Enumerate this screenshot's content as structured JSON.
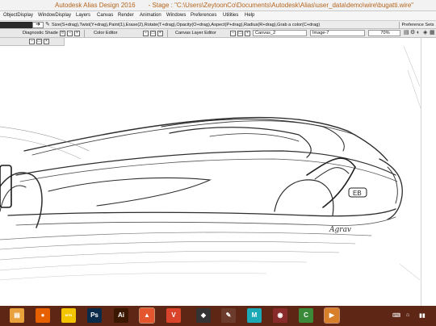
{
  "window": {
    "app_title": "Autodesk Alias Design 2016",
    "stage_title": "- Stage : \"C:\\Users\\ZeytoonCo\\Documents\\Autodesk\\Alias\\user_data\\demo\\wire\\bugatti.wire\""
  },
  "menu": [
    "ObjectDisplay",
    "WindowDisplay",
    "Layers",
    "Canvas",
    "Render",
    "Animation",
    "Windows",
    "Preferences",
    "Utilities",
    "Help"
  ],
  "toolbar": {
    "arrow": "➔",
    "hint": "Size(S+drag),Twist(Y+drag),Paint(1),Erase(2),Rotate(T+drag),Opacity(O+drag),Aspect(P+drag),Radius(R+drag),Grab a color(C+drag)",
    "preference_sets": "Preference Sets"
  },
  "panels": {
    "diagnostic_shade": "Diagnostic Shade",
    "color_editor": "Color Editor",
    "canvas_layer_editor": "Canvas Layer Editor",
    "canvas_name": "Canvas_2",
    "image_name": "Image-7",
    "zoom": "70%"
  },
  "taskbar": {
    "items": [
      {
        "name": "windows-explorer",
        "glyph": "▤",
        "color": "#e9a23b"
      },
      {
        "name": "firefox",
        "glyph": "●",
        "color": "#e66000"
      },
      {
        "name": "mtn-irancell",
        "glyph": "MTN",
        "color": "#f4c400"
      },
      {
        "name": "photoshop",
        "glyph": "Ps",
        "color": "#0a2a4a"
      },
      {
        "name": "illustrator",
        "glyph": "Ai",
        "color": "#3b1700"
      },
      {
        "name": "alias",
        "glyph": "▲",
        "color": "#e4572e"
      },
      {
        "name": "vred",
        "glyph": "V",
        "color": "#d9442b"
      },
      {
        "name": "sketchbook",
        "glyph": "◆",
        "color": "#333333"
      },
      {
        "name": "pencil-app",
        "glyph": "✎",
        "color": "#6b3b2b"
      },
      {
        "name": "maya",
        "glyph": "M",
        "color": "#1aa9b5"
      },
      {
        "name": "showcase",
        "glyph": "◉",
        "color": "#8a2b2b"
      },
      {
        "name": "camtasia",
        "glyph": "C",
        "color": "#3a8a3a"
      },
      {
        "name": "media-player",
        "glyph": "▶",
        "color": "#d87f2a"
      }
    ],
    "tray": [
      "⌨",
      "⌂",
      "▮▮"
    ]
  },
  "signature_text": "Agrav"
}
